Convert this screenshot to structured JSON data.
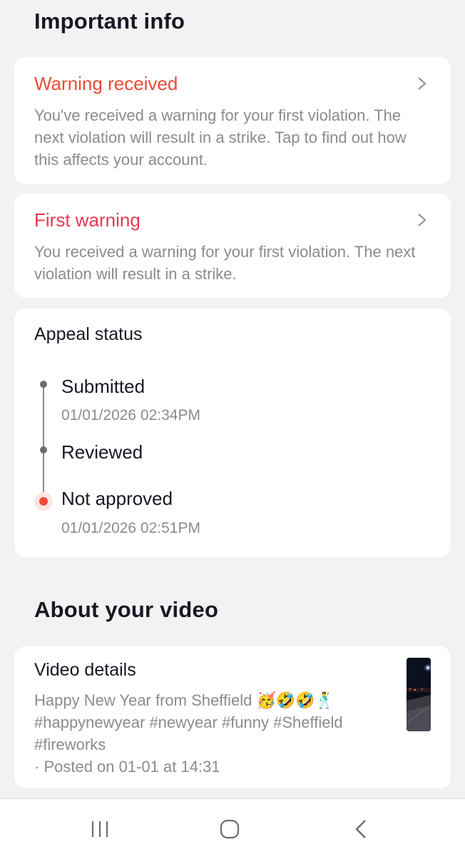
{
  "sections": {
    "important_info": "Important info",
    "about_video": "About your video"
  },
  "warning_card": {
    "title": "Warning received",
    "body": "You've received a warning for your first violation. The next violation will result in a strike. Tap to find out how this affects your account.",
    "icon": "chevron-right-icon",
    "title_color": "#e84b34"
  },
  "first_warning_card": {
    "title": "First warning",
    "body": "You received a warning for your first violation. The next violation will result in a strike.",
    "icon": "chevron-right-icon",
    "title_color": "#e8374f"
  },
  "appeal": {
    "title": "Appeal status",
    "steps": [
      {
        "label": "Submitted",
        "date": "01/01/2026 02:34PM"
      },
      {
        "label": "Reviewed",
        "date": ""
      },
      {
        "label": "Not approved",
        "date": "01/01/2026 02:51PM"
      }
    ],
    "status_color": "#f04a3a"
  },
  "video": {
    "title": "Video details",
    "caption_line1": "Happy New Year from Sheffield 🥳🤣🤣🕺",
    "caption_line2": "#happynewyear #newyear #funny #Sheffield",
    "caption_line3": "#fireworks",
    "posted": "· Posted on 01-01 at 14:31"
  },
  "navbar": {
    "items": [
      "recent-apps-icon",
      "home-icon",
      "back-icon"
    ]
  }
}
